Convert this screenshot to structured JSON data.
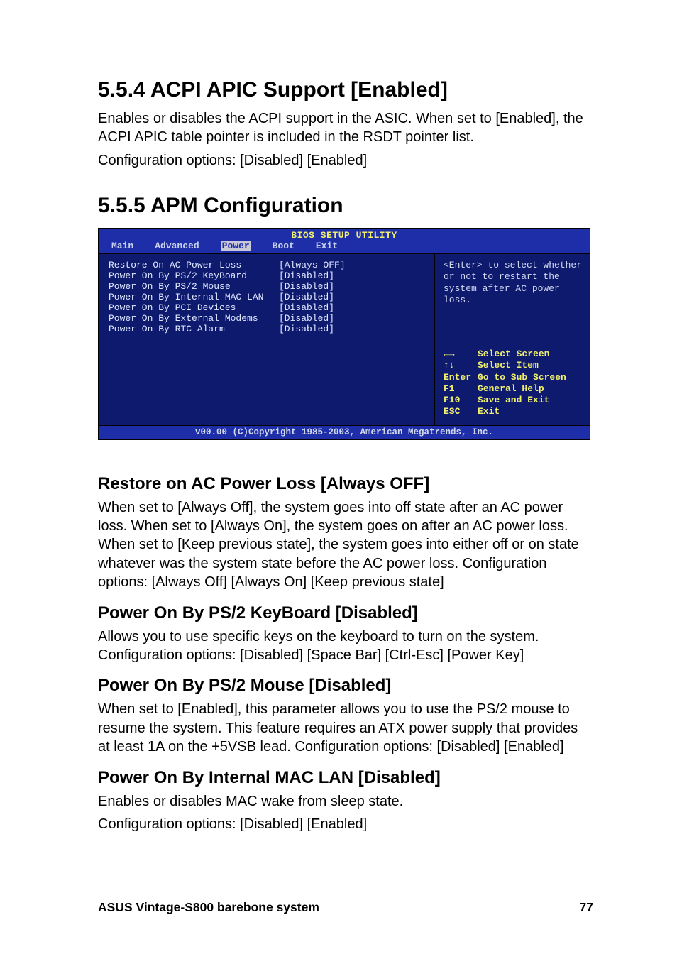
{
  "sections": {
    "s1": {
      "heading": "5.5.4  ACPI APIC Support [Enabled]",
      "p1": "Enables or disables the ACPI support in the ASIC. When set to [Enabled], the ACPI APIC table pointer is included in the RSDT pointer list.",
      "p2": "Configuration options: [Disabled] [Enabled]"
    },
    "s2": {
      "heading": "5.5.5  APM Configuration"
    },
    "s3": {
      "heading": "Restore on AC Power Loss [Always OFF]",
      "p1": "When set to [Always Off], the system goes into off state after an AC power loss. When set to [Always On], the system goes on after an AC power loss. When set to [Keep previous state], the system goes into either off or on state whatever was the system state before the AC power loss. Configuration options: [Always Off] [Always On] [Keep previous state]"
    },
    "s4": {
      "heading": "Power On By PS/2 KeyBoard [Disabled]",
      "p1": "Allows you to use specific keys on the keyboard to turn on the system. Configuration options: [Disabled] [Space Bar] [Ctrl-Esc] [Power Key]"
    },
    "s5": {
      "heading": "Power On By PS/2 Mouse [Disabled]",
      "p1": "When set to [Enabled], this parameter allows you to use the PS/2 mouse to resume the system. This feature requires an ATX power supply that provides at least 1A on the +5VSB lead. Configuration options: [Disabled] [Enabled]"
    },
    "s6": {
      "heading": "Power On By Internal MAC LAN [Disabled]",
      "p1": "Enables or disables MAC wake from sleep state.",
      "p2": "Configuration options: [Disabled] [Enabled]"
    }
  },
  "bios": {
    "title": "BIOS SETUP UTILITY",
    "tabs": {
      "t0": "Main",
      "t1": "Advanced",
      "t2": "Power",
      "t3": "Boot",
      "t4": "Exit"
    },
    "rows": [
      {
        "label": "Restore On AC Power Loss",
        "val": "[Always OFF]"
      },
      {
        "label": "Power On By PS/2 KeyBoard",
        "val": "[Disabled]"
      },
      {
        "label": "Power On By PS/2 Mouse",
        "val": "[Disabled]"
      },
      {
        "label": "Power On By Internal MAC LAN",
        "val": "[Disabled]"
      },
      {
        "label": "Power On By PCI Devices",
        "val": "[Disabled]"
      },
      {
        "label": "Power On By External Modems",
        "val": "[Disabled]"
      },
      {
        "label": "Power On By RTC Alarm",
        "val": "[Disabled]"
      }
    ],
    "help": "<Enter> to select whether or not to restart the system after AC power loss.",
    "keys": [
      {
        "k": "←→",
        "a": "Select Screen"
      },
      {
        "k": "↑↓",
        "a": "Select Item"
      },
      {
        "k": "Enter",
        "a": "Go to Sub Screen"
      },
      {
        "k": "F1",
        "a": "General Help"
      },
      {
        "k": "F10",
        "a": "Save and Exit"
      },
      {
        "k": "ESC",
        "a": "Exit"
      }
    ],
    "footer": "v00.00 (C)Copyright 1985-2003, American Megatrends, Inc."
  },
  "footer": {
    "left": "ASUS Vintage-S800 barebone system",
    "right": "77"
  }
}
